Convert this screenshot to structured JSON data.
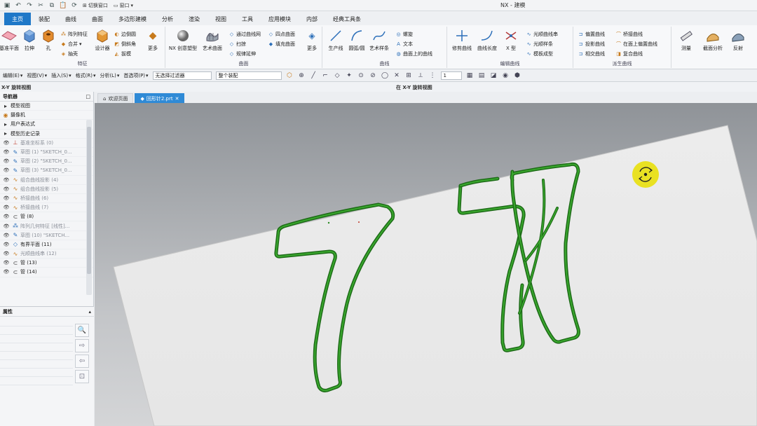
{
  "app": {
    "title": "NX - 建模"
  },
  "quick_access": {
    "window_switch": "切换窗口",
    "window": "窗口"
  },
  "tabs": [
    "主页",
    "装配",
    "曲线",
    "曲面",
    "多边形建模",
    "分析",
    "渲染",
    "视图",
    "工具",
    "应用模块",
    "内部",
    "经典工具条"
  ],
  "ribbon": {
    "feature": {
      "label": "特征",
      "big": [
        "基准平面",
        "拉伸",
        "孔"
      ],
      "small": [
        "阵列特征",
        "合并",
        "抽壳"
      ],
      "big2": [
        "设计器",
        "更多"
      ],
      "small2": [
        "边倒圆",
        "倒斜角",
        "拔模"
      ]
    },
    "surface": {
      "label": "曲面",
      "big": [
        "NX 创意塑型",
        "艺术曲面"
      ],
      "small": [
        "通过曲线网",
        "扫掠",
        "规律延伸",
        "四点曲面",
        "填充曲面"
      ],
      "more": "更多"
    },
    "curve": {
      "label": "曲线",
      "big": [
        "生产线",
        "圆弧/圆",
        "艺术样条"
      ],
      "small": [
        "螺旋",
        "文本",
        "曲面上的曲线"
      ]
    },
    "edit_curve": {
      "label": "编辑曲线",
      "big": [
        "修剪曲线",
        "曲线长度",
        "X 型"
      ],
      "small": [
        "光顺曲线串",
        "光顺样条",
        "模板成型"
      ]
    },
    "derived": {
      "label": "派生曲线",
      "small": [
        "偏置曲线",
        "投影曲线",
        "相交曲线",
        "桥接曲线",
        "在面上偏置曲线",
        "复合曲线"
      ]
    },
    "analysis": {
      "big": [
        "测量",
        "截面分析",
        "反射"
      ]
    }
  },
  "cmdbar": {
    "items": [
      "编辑(E)",
      "视图(V)",
      "插入(S)",
      "格式(R)",
      "分析(L)",
      "首选项(P)"
    ],
    "filter1": "无选择过滤器",
    "filter2": "整个装配",
    "field": "1"
  },
  "strip": {
    "left": "X-Y 旋转视图",
    "center": "在 X-Y 旋转视图"
  },
  "navigator": {
    "title": "导航器",
    "rows": [
      {
        "label": "模型视图",
        "dim": false,
        "icon": "folder"
      },
      {
        "label": "摄像机",
        "dim": false,
        "icon": "camera"
      },
      {
        "label": "用户表达式",
        "dim": false,
        "icon": "folder"
      },
      {
        "label": "模型历史记录",
        "dim": false,
        "icon": "folder"
      },
      {
        "label": "基准坐标系 (0)",
        "dim": true,
        "icon": "datum"
      },
      {
        "label": "草图 (1) \"SKETCH_0...",
        "dim": true,
        "icon": "sketch"
      },
      {
        "label": "草图 (2) \"SKETCH_0...",
        "dim": true,
        "icon": "sketch"
      },
      {
        "label": "草图 (3) \"SKETCH_0...",
        "dim": true,
        "icon": "sketch"
      },
      {
        "label": "组合曲线投影 (4)",
        "dim": true,
        "icon": "curve"
      },
      {
        "label": "组合曲线投影 (5)",
        "dim": true,
        "icon": "curve"
      },
      {
        "label": "桥接曲线 (6)",
        "dim": true,
        "icon": "curve"
      },
      {
        "label": "桥接曲线 (7)",
        "dim": true,
        "icon": "curve"
      },
      {
        "label": "管 (8)",
        "dim": false,
        "icon": "tube"
      },
      {
        "label": "阵列几何特征 [线性]...",
        "dim": true,
        "icon": "pattern"
      },
      {
        "label": "草图 (10) \"SKETCH...",
        "dim": true,
        "icon": "sketch"
      },
      {
        "label": "有界平面 (11)",
        "dim": false,
        "icon": "plane"
      },
      {
        "label": "光顺曲线串 (12)",
        "dim": true,
        "icon": "curve"
      },
      {
        "label": "管 (13)",
        "dim": false,
        "icon": "tube"
      },
      {
        "label": "管 (14)",
        "dim": false,
        "icon": "tube"
      }
    ]
  },
  "properties": {
    "title": "属性"
  },
  "doc_tabs": [
    {
      "label": "欢迎页面",
      "active": false
    },
    {
      "label": "回形针2.prt",
      "active": true
    }
  ],
  "colors": {
    "accent": "#1f78c8",
    "wire": "#2a8a22",
    "rotate_badge": "#e8df10"
  }
}
